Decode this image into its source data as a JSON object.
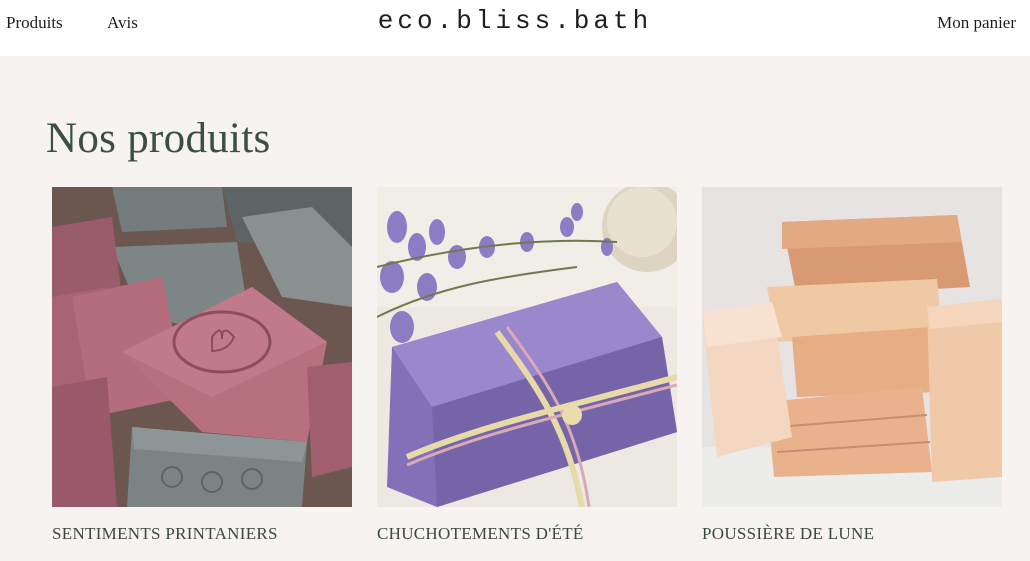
{
  "nav": {
    "products_label": "Produits",
    "reviews_label": "Avis",
    "brand": "eco.bliss.bath",
    "cart_label": "Mon panier"
  },
  "main": {
    "heading": "Nos produits",
    "products": [
      {
        "name": "SENTIMENTS PRINTANIERS",
        "image": "pink-grey-soap-bars-photo"
      },
      {
        "name": "CHUCHOTEMENTS D'ÉTÉ",
        "image": "lavender-soap-bar-photo"
      },
      {
        "name": "POUSSIÈRE DE LUNE",
        "image": "peach-soap-stack-photo"
      }
    ]
  },
  "colors": {
    "background": "#f7f3f1",
    "header": "#ffffff",
    "heading_text": "#3c4e48",
    "product_name": "#3a4742"
  }
}
